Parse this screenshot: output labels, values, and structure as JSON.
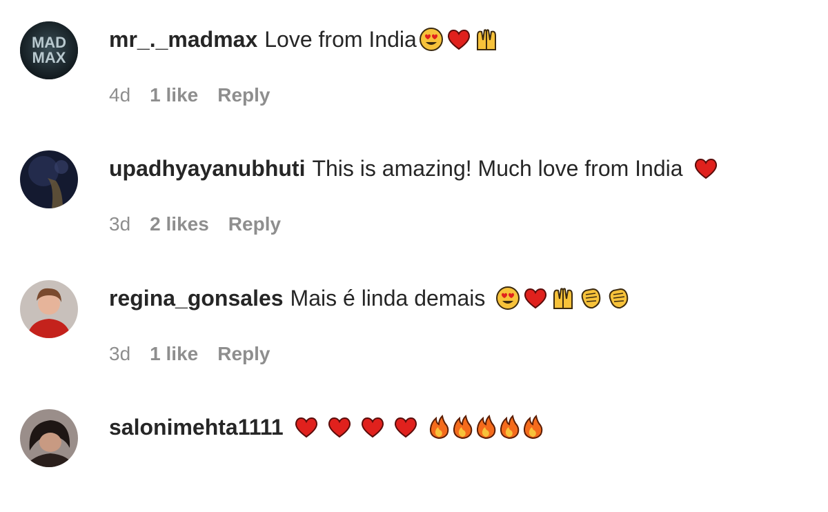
{
  "comments": [
    {
      "username": "mr_._madmax",
      "text": "Love from India",
      "emojis": [
        "heart-eyes",
        "red-heart",
        "raising-hands"
      ],
      "time": "4d",
      "likes": "1 like",
      "reply": "Reply",
      "avatar_text": [
        "MAD",
        "MAX"
      ]
    },
    {
      "username": "upadhyayanubhuti",
      "text": "This is amazing! Much love from India",
      "emojis": [
        "red-heart"
      ],
      "time": "3d",
      "likes": "2 likes",
      "reply": "Reply"
    },
    {
      "username": "regina_gonsales",
      "text": "Mais é linda demais",
      "emojis": [
        "heart-eyes",
        "red-heart",
        "raising-hands",
        "clapping-hands",
        "clapping-hands"
      ],
      "time": "3d",
      "likes": "1 like",
      "reply": "Reply"
    },
    {
      "username": "salonimehta1111",
      "text": "",
      "emojis": [
        "red-heart",
        "red-heart",
        "red-heart",
        "red-heart",
        "fire",
        "fire",
        "fire",
        "fire",
        "fire"
      ]
    }
  ],
  "colors": {
    "text": "#262626",
    "secondary": "#8e8e8e",
    "heart": "#e0211d",
    "emoji_yellow": "#f7c23a",
    "fire": "#f46b1c"
  }
}
